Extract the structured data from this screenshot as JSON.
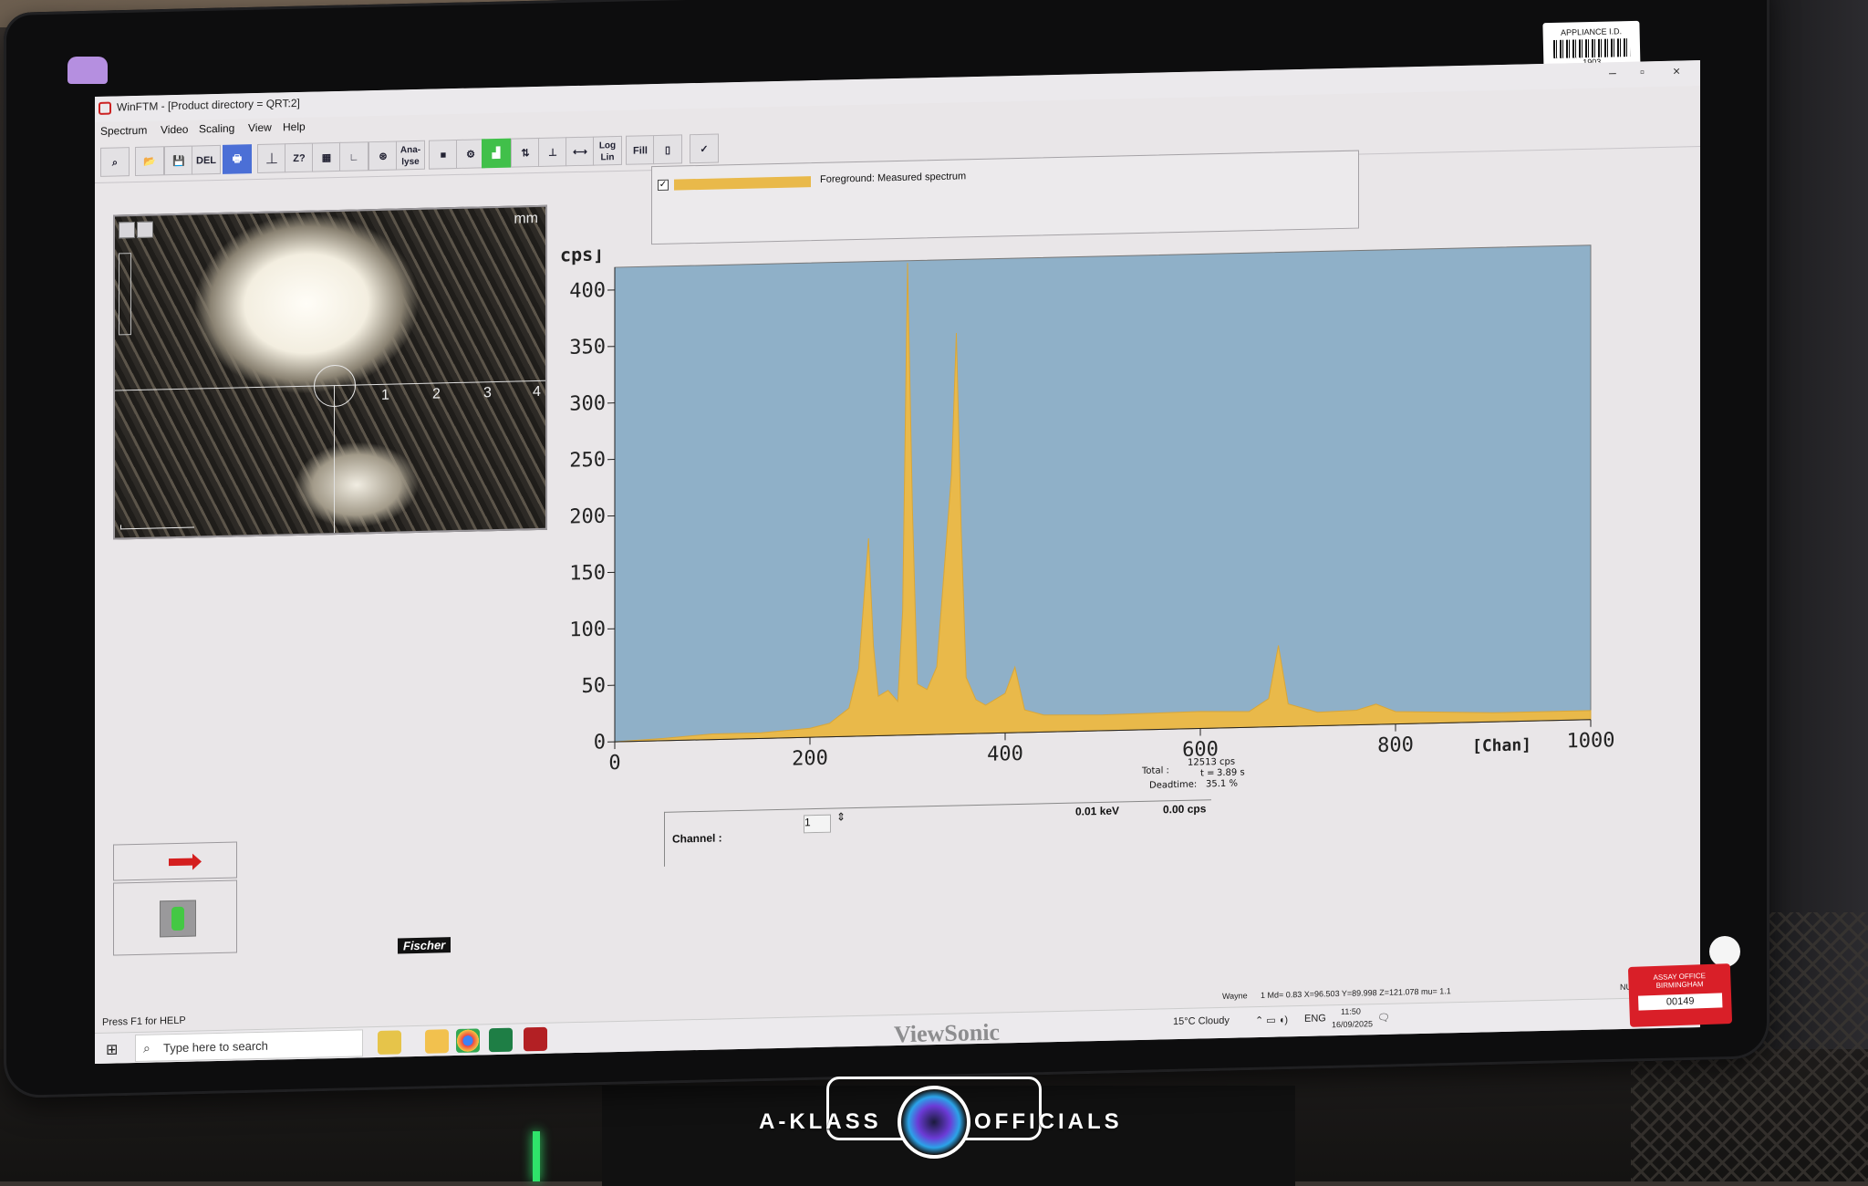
{
  "window": {
    "title": "WinFTM - [Product directory = QRT:2]",
    "minimize": "–",
    "maximize": "▫",
    "close": "×"
  },
  "menu": [
    "Spectrum",
    "Video",
    "Scaling",
    "View",
    "Help"
  ],
  "toolbar": {
    "buttons": [
      {
        "name": "zoom-icon",
        "label": "⌕"
      },
      {
        "name": "open-folder-icon",
        "label": "📂"
      },
      {
        "name": "save-icon",
        "label": "💾"
      },
      {
        "name": "delete-icon",
        "label": "DEL"
      },
      {
        "name": "print-icon",
        "label": "🖶"
      },
      {
        "name": "peak-marker-icon",
        "label": "⏊"
      },
      {
        "name": "element-z-icon",
        "label": "Z?"
      },
      {
        "name": "periodic-table-icon",
        "label": "▦"
      },
      {
        "name": "axis-icon",
        "label": "∟"
      },
      {
        "name": "element-search-icon",
        "label": "⊛"
      },
      {
        "name": "analyse-button",
        "label": "Ana-\nlyse"
      },
      {
        "name": "stop-icon",
        "label": "■"
      },
      {
        "name": "settings-icon",
        "label": "⚙"
      },
      {
        "name": "spectrum-view-icon",
        "label": "▟"
      },
      {
        "name": "scale-up-icon",
        "label": "⇅"
      },
      {
        "name": "scale-reset-icon",
        "label": "⊥"
      },
      {
        "name": "scale-x-icon",
        "label": "⟷"
      },
      {
        "name": "log-lin-button",
        "label": "Log\nLin"
      },
      {
        "name": "fill-button",
        "label": "Fill"
      },
      {
        "name": "exit-icon",
        "label": "▯"
      },
      {
        "name": "checklist-icon",
        "label": "✓"
      }
    ]
  },
  "camera": {
    "unit": "mm",
    "scale_ticks": [
      "1",
      "2",
      "3",
      "4"
    ]
  },
  "legend": {
    "checked": "✓",
    "label": "Foreground: Measured spectrum",
    "color": "#e9b94a"
  },
  "chart_data": {
    "type": "area",
    "ylabel": "[cps]",
    "xlabel": "[Chan]",
    "xlim": [
      0,
      1000
    ],
    "ylim": [
      0,
      420
    ],
    "y_ticks": [
      0,
      50,
      100,
      150,
      200,
      250,
      300,
      350,
      400
    ],
    "x_ticks": [
      0,
      200,
      400,
      600,
      800,
      1000
    ],
    "background": "#8fb0c8",
    "fill_color": "#e9b94a",
    "series": [
      {
        "x": [
          0,
          50,
          100,
          150,
          200,
          220,
          240,
          250,
          260,
          265,
          270,
          280,
          290,
          295,
          300,
          305,
          310,
          320,
          330,
          345,
          350,
          355,
          360,
          370,
          380,
          400,
          410,
          420,
          440,
          500,
          600,
          650,
          670,
          680,
          690,
          720,
          760,
          780,
          800,
          900,
          1000
        ],
        "y": [
          0,
          2,
          5,
          5,
          8,
          12,
          25,
          60,
          175,
          80,
          35,
          40,
          30,
          110,
          418,
          200,
          45,
          40,
          60,
          230,
          355,
          180,
          50,
          30,
          25,
          35,
          58,
          20,
          15,
          14,
          15,
          14,
          25,
          72,
          20,
          12,
          13,
          18,
          11,
          8,
          8
        ]
      }
    ]
  },
  "hud": {
    "total_label": "Total :",
    "total_cps": "12513 cps",
    "time_label": "t =",
    "time_value": "3.89 s",
    "deadtime_label": "Deadtime:",
    "deadtime_value": "35.1 %"
  },
  "readout": {
    "channel_label": "Channel :",
    "channel_value": "1",
    "energy": "0.01 keV",
    "rate": "0.00 cps"
  },
  "status": {
    "help": "Press F1 for HELP",
    "user": "Wayne",
    "coords": "1 Md= 0.83 X=96.503 Y=89.998 Z=121.078 mu= 1.1",
    "num": "NUM"
  },
  "taskbar": {
    "search_placeholder": "Type here to search",
    "weather": "15°C Cloudy",
    "lang": "ENG",
    "time": "11:50",
    "date": "16/09/2025"
  },
  "logo": {
    "fischer": "Fischer"
  },
  "stickers": {
    "appliance_title": "APPLIANCE I.D.",
    "appliance_number": "1903",
    "assay_line1": "ASSAY OFFICE",
    "assay_line2": "BIRMINGHAM",
    "assay_number": "00149"
  },
  "brand": "ViewSonic",
  "watermark": {
    "left": "A-KLASS",
    "right": "OFFICIALS"
  }
}
